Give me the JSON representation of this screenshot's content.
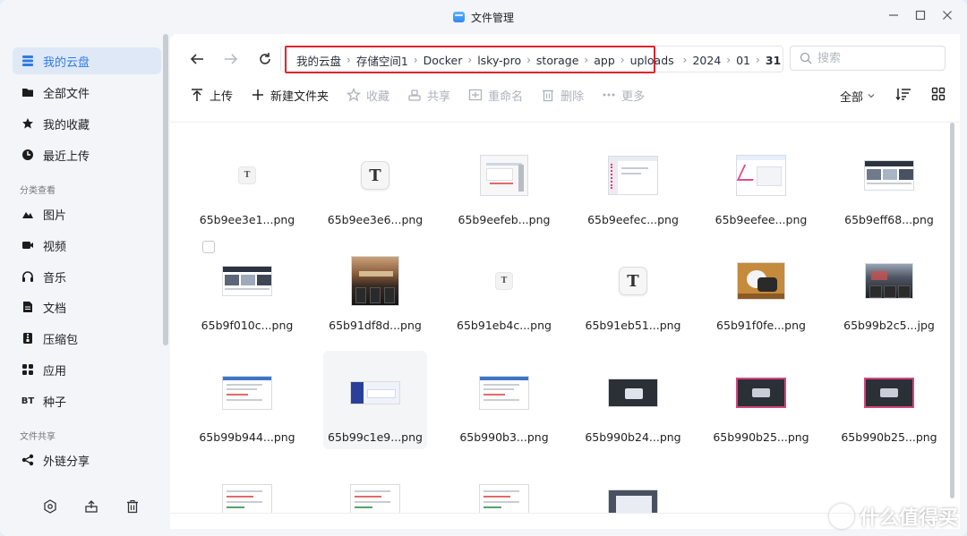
{
  "window": {
    "title": "文件管理"
  },
  "sidebar": {
    "items": [
      {
        "label": "我的云盘",
        "icon": "stack-icon"
      },
      {
        "label": "全部文件",
        "icon": "folder-icon"
      },
      {
        "label": "我的收藏",
        "icon": "star-icon"
      },
      {
        "label": "最近上传",
        "icon": "clock-icon"
      }
    ],
    "section_category": "分类查看",
    "categories": [
      {
        "label": "图片",
        "icon": "mountain-icon"
      },
      {
        "label": "视频",
        "icon": "video-icon"
      },
      {
        "label": "音乐",
        "icon": "headphones-icon"
      },
      {
        "label": "文档",
        "icon": "document-icon"
      },
      {
        "label": "压缩包",
        "icon": "archive-icon"
      },
      {
        "label": "应用",
        "icon": "apps-icon"
      },
      {
        "label": "种子",
        "icon": "bt-icon",
        "icon_text": "BT"
      }
    ],
    "section_share": "文件共享",
    "share_items": [
      {
        "label": "外链分享",
        "icon": "share-icon"
      }
    ]
  },
  "breadcrumb": {
    "items": [
      "我的云盘",
      "存储空间1",
      "Docker",
      "lsky-pro",
      "storage",
      "app",
      "uploads",
      "2024",
      "01",
      "31"
    ]
  },
  "search": {
    "placeholder": "搜索"
  },
  "toolbar": {
    "upload": "上传",
    "new_folder": "新建文件夹",
    "favorite": "收藏",
    "share": "共享",
    "rename": "重命名",
    "delete": "删除",
    "more": "更多"
  },
  "view": {
    "filter": "全部"
  },
  "files": [
    {
      "name": "65b9ee3e1...png",
      "thumb": "t-small"
    },
    {
      "name": "65b9ee3e6...png",
      "thumb": "t-big"
    },
    {
      "name": "65b9eefeb...png",
      "thumb": "shot-a"
    },
    {
      "name": "65b9eefec...png",
      "thumb": "shot-b"
    },
    {
      "name": "65b9eefee...png",
      "thumb": "shot-c"
    },
    {
      "name": "65b9eff68...png",
      "thumb": "shot-d"
    },
    {
      "name": "65b9f010c...png",
      "thumb": "shot-e"
    },
    {
      "name": "65b91df8d...png",
      "thumb": "photo-a"
    },
    {
      "name": "65b91eb4c...png",
      "thumb": "t-small"
    },
    {
      "name": "65b91eb51...png",
      "thumb": "t-big"
    },
    {
      "name": "65b91f0fe...png",
      "thumb": "photo-b"
    },
    {
      "name": "65b99b2c5...jpg",
      "thumb": "photo-c"
    },
    {
      "name": "65b99b944...png",
      "thumb": "shot-f"
    },
    {
      "name": "65b99c1e9...png",
      "thumb": "shot-g"
    },
    {
      "name": "65b990b3...png",
      "thumb": "shot-f"
    },
    {
      "name": "65b990b24...png",
      "thumb": "shot-dark"
    },
    {
      "name": "65b990b25...png",
      "thumb": "shot-dark-pink"
    },
    {
      "name": "65b990b25...png",
      "thumb": "shot-dark-pink"
    },
    {
      "name": "",
      "thumb": "shot-f"
    },
    {
      "name": "",
      "thumb": "shot-f"
    },
    {
      "name": "",
      "thumb": "shot-f"
    },
    {
      "name": "",
      "thumb": "shot-h"
    }
  ],
  "watermark": {
    "text": "什么值得买"
  },
  "colors": {
    "accent": "#2f7be6",
    "highlight_border": "#e1232c"
  }
}
